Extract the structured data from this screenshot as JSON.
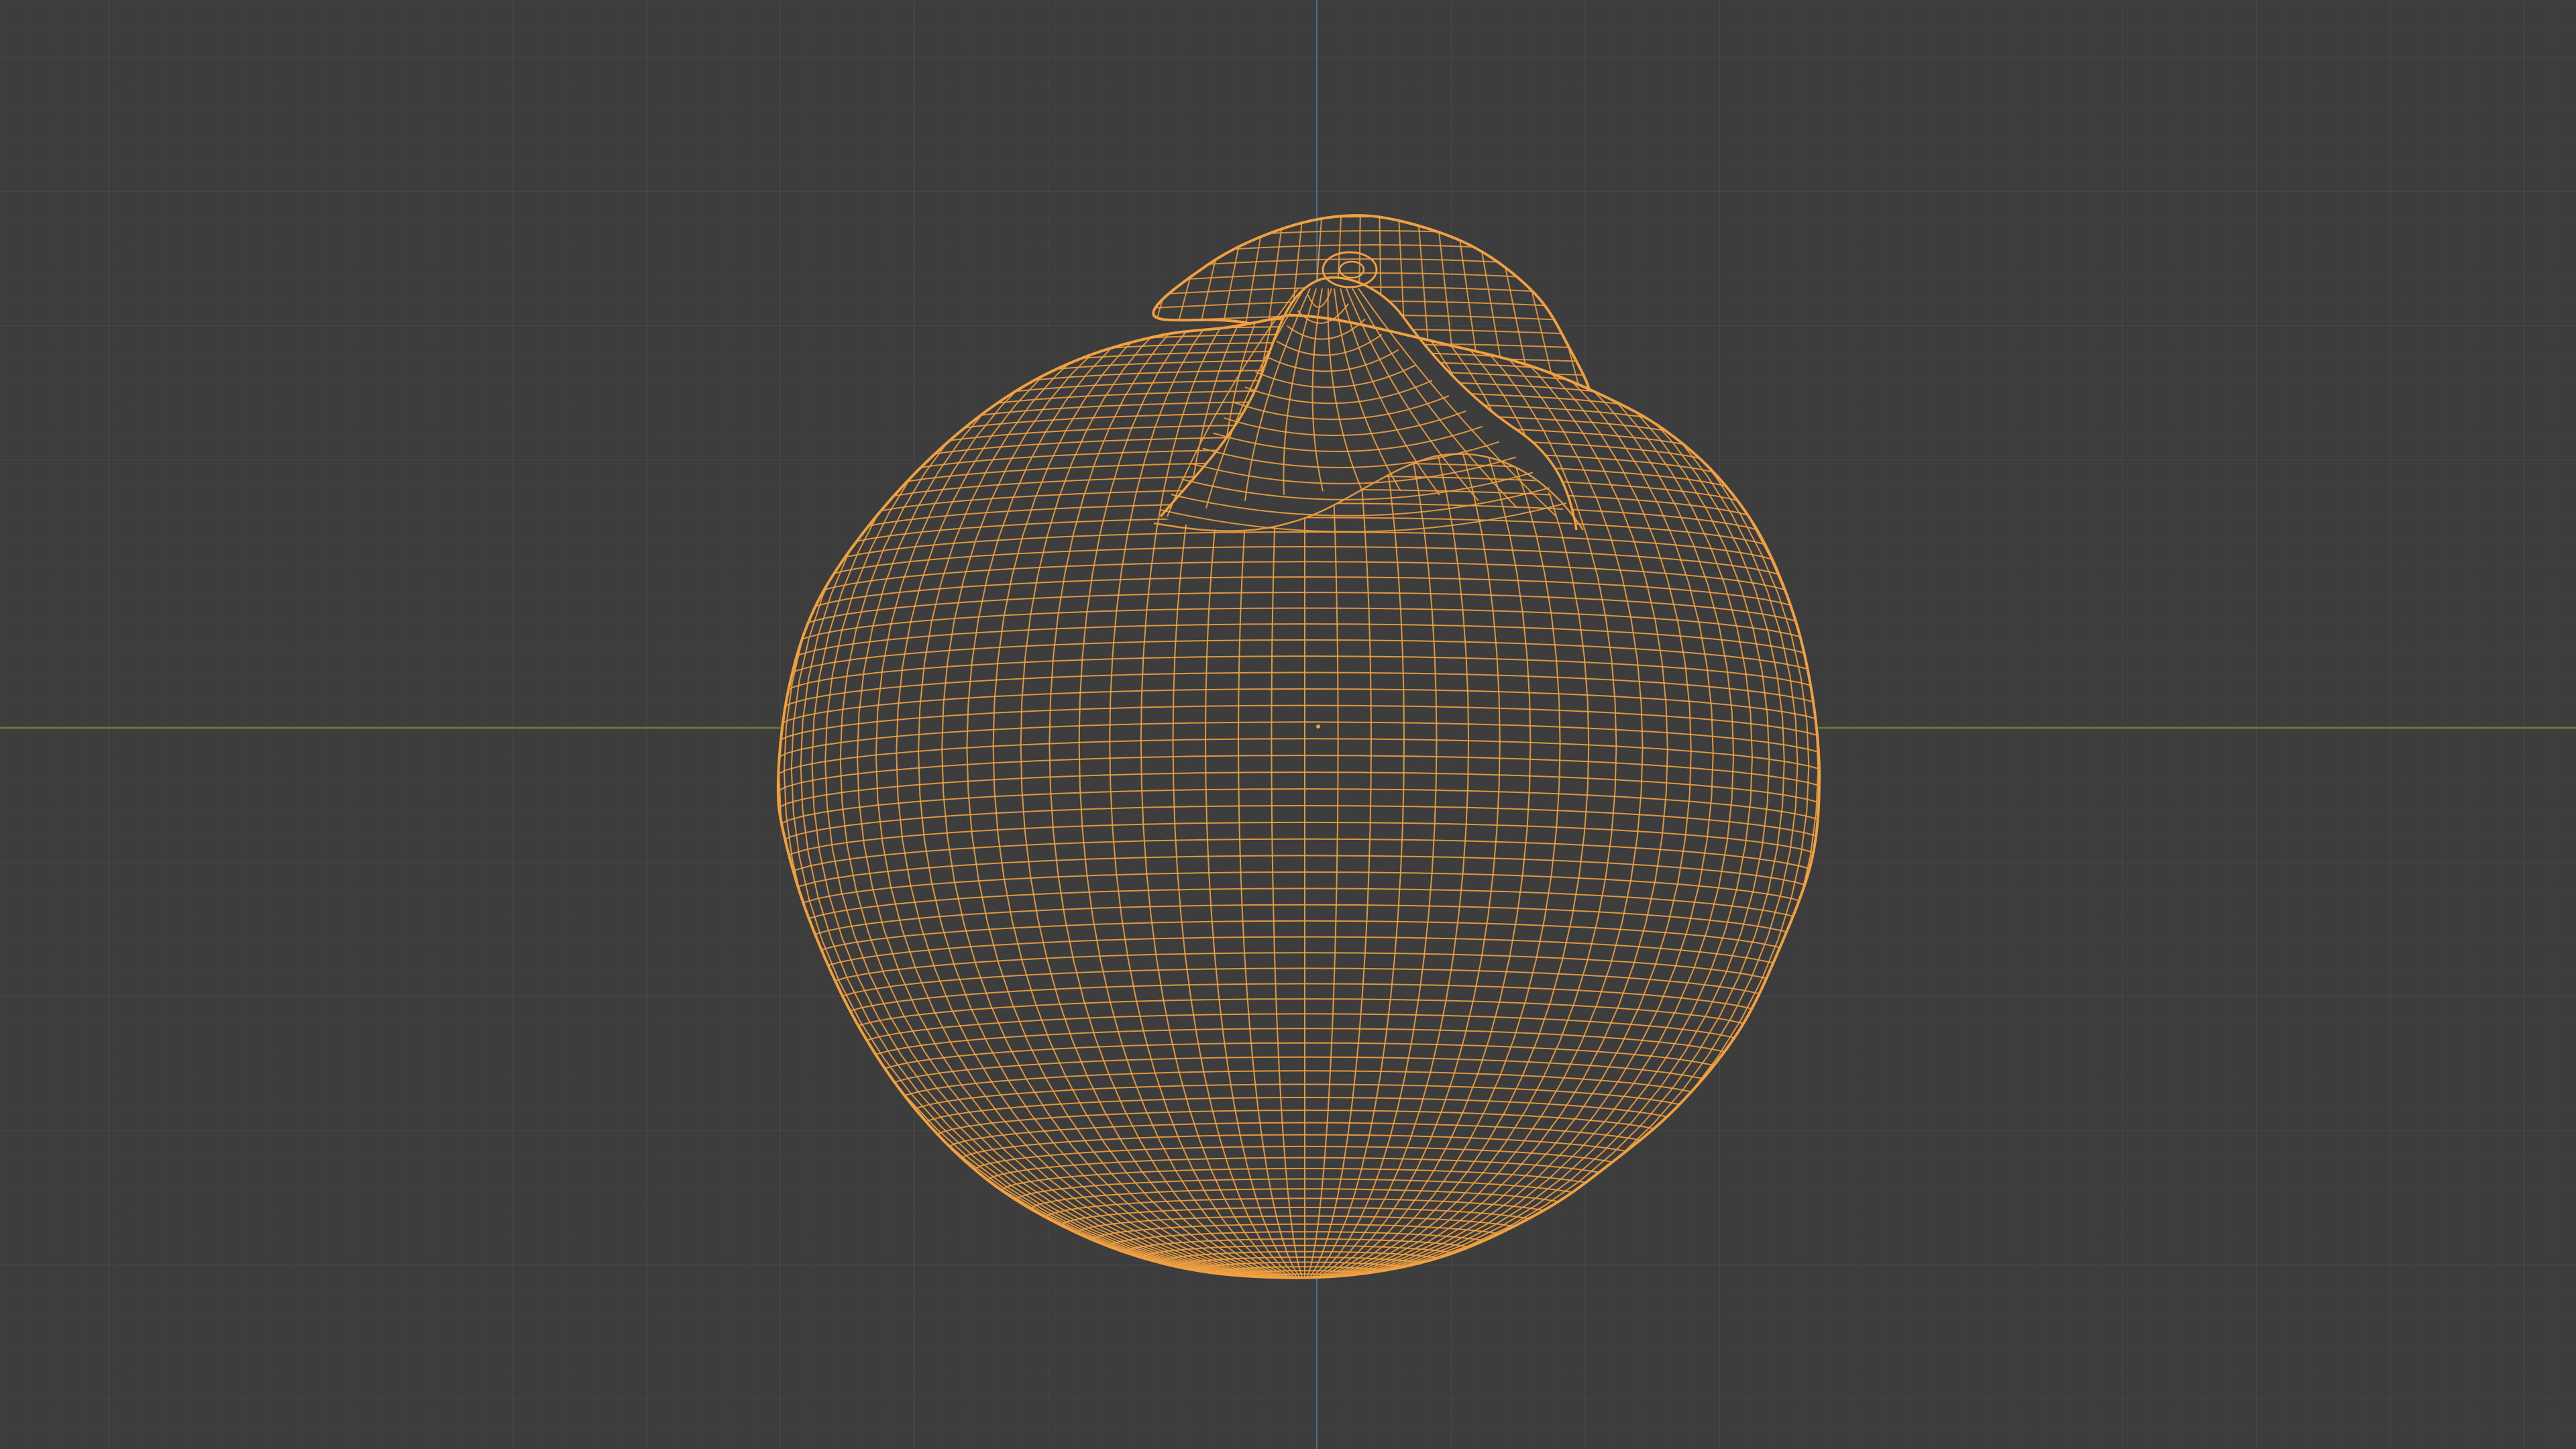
{
  "viewport": {
    "background": "#3d3d3d",
    "grid_minor_color": "#454545",
    "grid_major_color": "#4c4c4c",
    "x_axis_color": "#6b7f36",
    "y_axis_color": "#4a6a8a",
    "selection_color": "#f0a040",
    "display_mode": "wireframe",
    "object_state": "selected"
  }
}
